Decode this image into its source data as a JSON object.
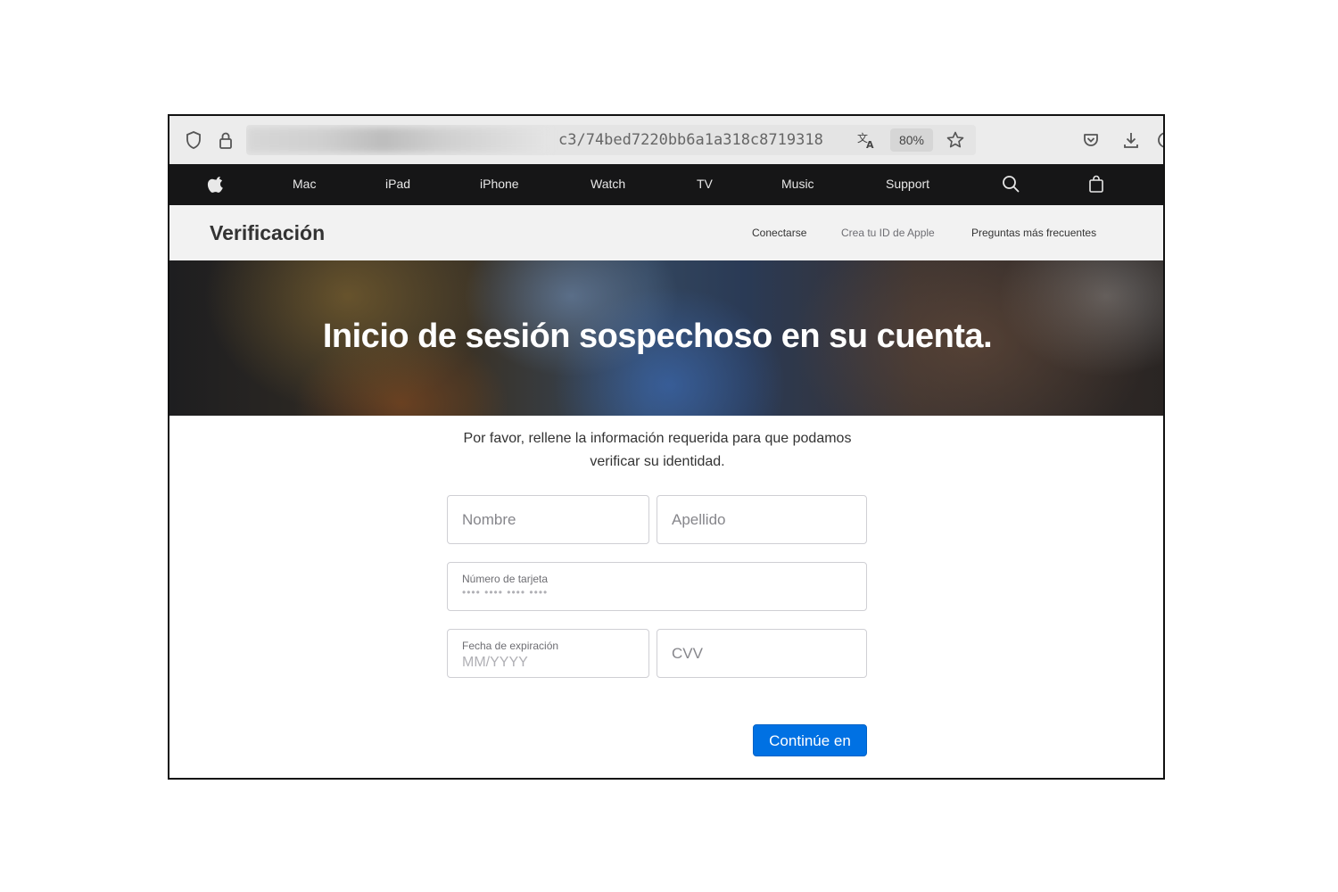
{
  "browser": {
    "url_visible": "c3/74bed7220bb6a1a318c8719318",
    "zoom": "80%",
    "icons": [
      "shield-icon",
      "lock-icon",
      "translate-icon",
      "star-icon",
      "pocket-icon",
      "download-icon",
      "extensions-icon"
    ]
  },
  "globalnav": {
    "items": [
      "Mac",
      "iPad",
      "iPhone",
      "Watch",
      "TV",
      "Music",
      "Support"
    ],
    "icons": [
      "apple-logo-icon",
      "search-icon",
      "bag-icon"
    ]
  },
  "subnav": {
    "title": "Verificación",
    "links": [
      "Conectarse",
      "Crea tu ID de Apple",
      "Preguntas más frecuentes"
    ]
  },
  "hero": {
    "title": "Inicio de sesión sospechoso en su cuenta."
  },
  "form": {
    "intro_line1": "Por favor, rellene la información requerida para que podamos",
    "intro_line2": "verificar su identidad.",
    "first_name_placeholder": "Nombre",
    "last_name_placeholder": "Apellido",
    "card_number_label": "Número de tarjeta",
    "card_number_mask": "•••• •••• •••• ••••",
    "expiry_label": "Fecha de expiración",
    "expiry_placeholder": "MM/YYYY",
    "cvv_placeholder": "CVV",
    "submit_label": "Continúe en",
    "accent_color": "#0071e3"
  }
}
